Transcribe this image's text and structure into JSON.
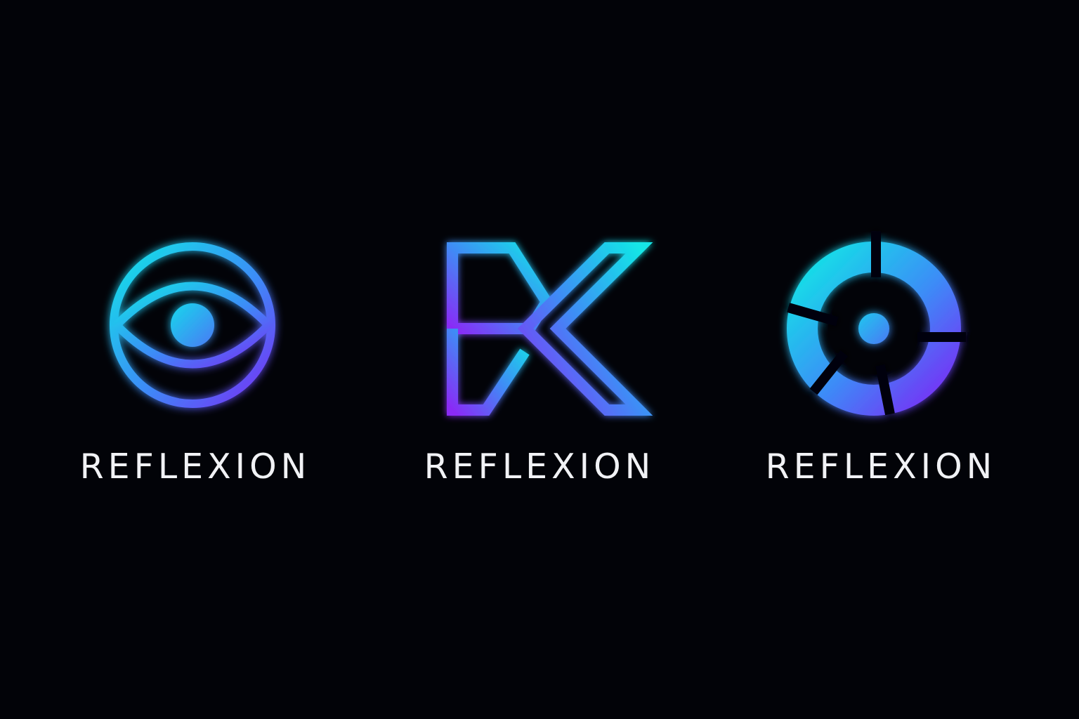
{
  "colors": {
    "background": "#020308",
    "gradient_cyan": "#12e6e6",
    "gradient_blue": "#3c8cf7",
    "gradient_violet": "#7a2cf6",
    "wordmark_text": "#f1f2f5"
  },
  "logos": [
    {
      "icon": "eye-in-circle-icon",
      "wordmark": "REFLEXION"
    },
    {
      "icon": "geometric-letter-k-icon",
      "wordmark": "REFLEXION"
    },
    {
      "icon": "segmented-ring-with-dot-icon",
      "wordmark": "REFLEXION"
    }
  ]
}
